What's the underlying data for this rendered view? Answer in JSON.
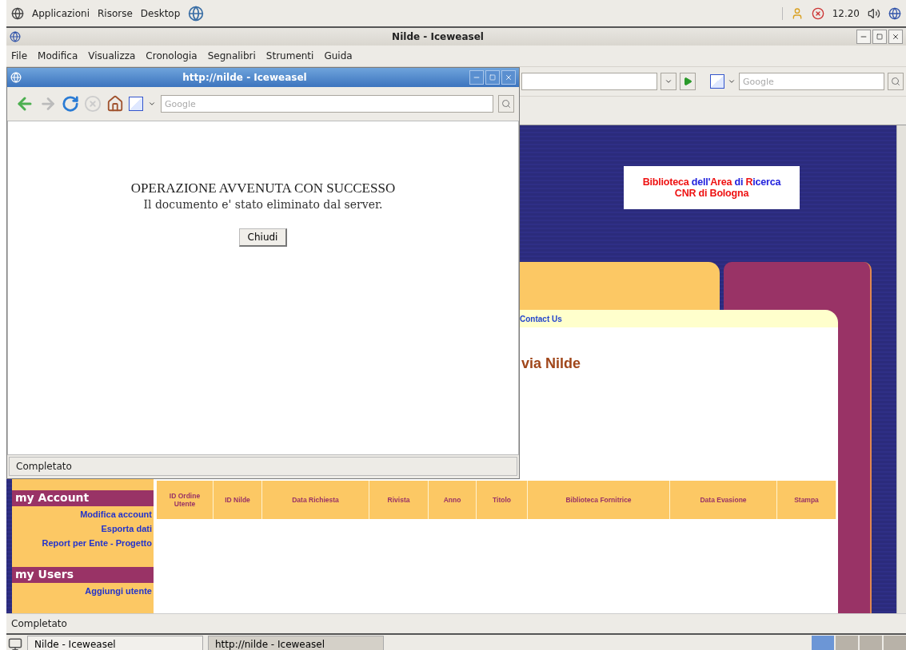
{
  "top_panel": {
    "menus": [
      "Applicazioni",
      "Risorse",
      "Desktop"
    ],
    "clock": "12.20"
  },
  "main_window": {
    "title": "Nilde - Iceweasel",
    "menu": [
      "File",
      "Modifica",
      "Visualizza",
      "Cronologia",
      "Segnalibri",
      "Strumenti",
      "Guida"
    ],
    "search": {
      "placeholder": "Google"
    },
    "page": {
      "banner": {
        "lines": [
          [
            {
              "text": "Biblioteca",
              "color": "#ee1111"
            },
            {
              "text": " dell'",
              "color": "#2222dd"
            },
            {
              "text": "Area",
              "color": "#ee1111"
            },
            {
              "text": " di ",
              "color": "#2222dd"
            },
            {
              "text": "R",
              "color": "#ee1111"
            },
            {
              "text": "icerca",
              "color": "#2222dd"
            }
          ],
          [
            {
              "text": "CNR di Bologna",
              "color": "#ee1111"
            }
          ]
        ]
      },
      "contact_link": "Contact Us",
      "heading": "via Nilde",
      "sidebar": [
        {
          "title": "my Account",
          "links": [
            "Modifica account",
            "Esporta dati",
            "Report per Ente - Progetto"
          ]
        },
        {
          "title": "my Users",
          "links": [
            "Aggiungi utente"
          ]
        }
      ],
      "table": {
        "columns": [
          "ID Ordine Utente",
          "ID Nilde",
          "Data Richiesta",
          "Rivista",
          "Anno",
          "Titolo",
          "Biblioteca Fornitrice",
          "Data Evasione",
          "Stampa"
        ]
      }
    },
    "status_bar": "Completato"
  },
  "popup": {
    "title": "http://nilde - Iceweasel",
    "search": {
      "placeholder": "Google"
    },
    "message_title": "OPERAZIONE AVVENUTA CON SUCCESSO",
    "message": "Il documento e' stato eliminato dal server.",
    "button": "Chiudi",
    "status_bar": "Completato"
  },
  "taskbar": [
    {
      "label": "Nilde - Iceweasel",
      "selected": false
    },
    {
      "label": "http://nilde - Iceweasel",
      "selected": true
    }
  ]
}
